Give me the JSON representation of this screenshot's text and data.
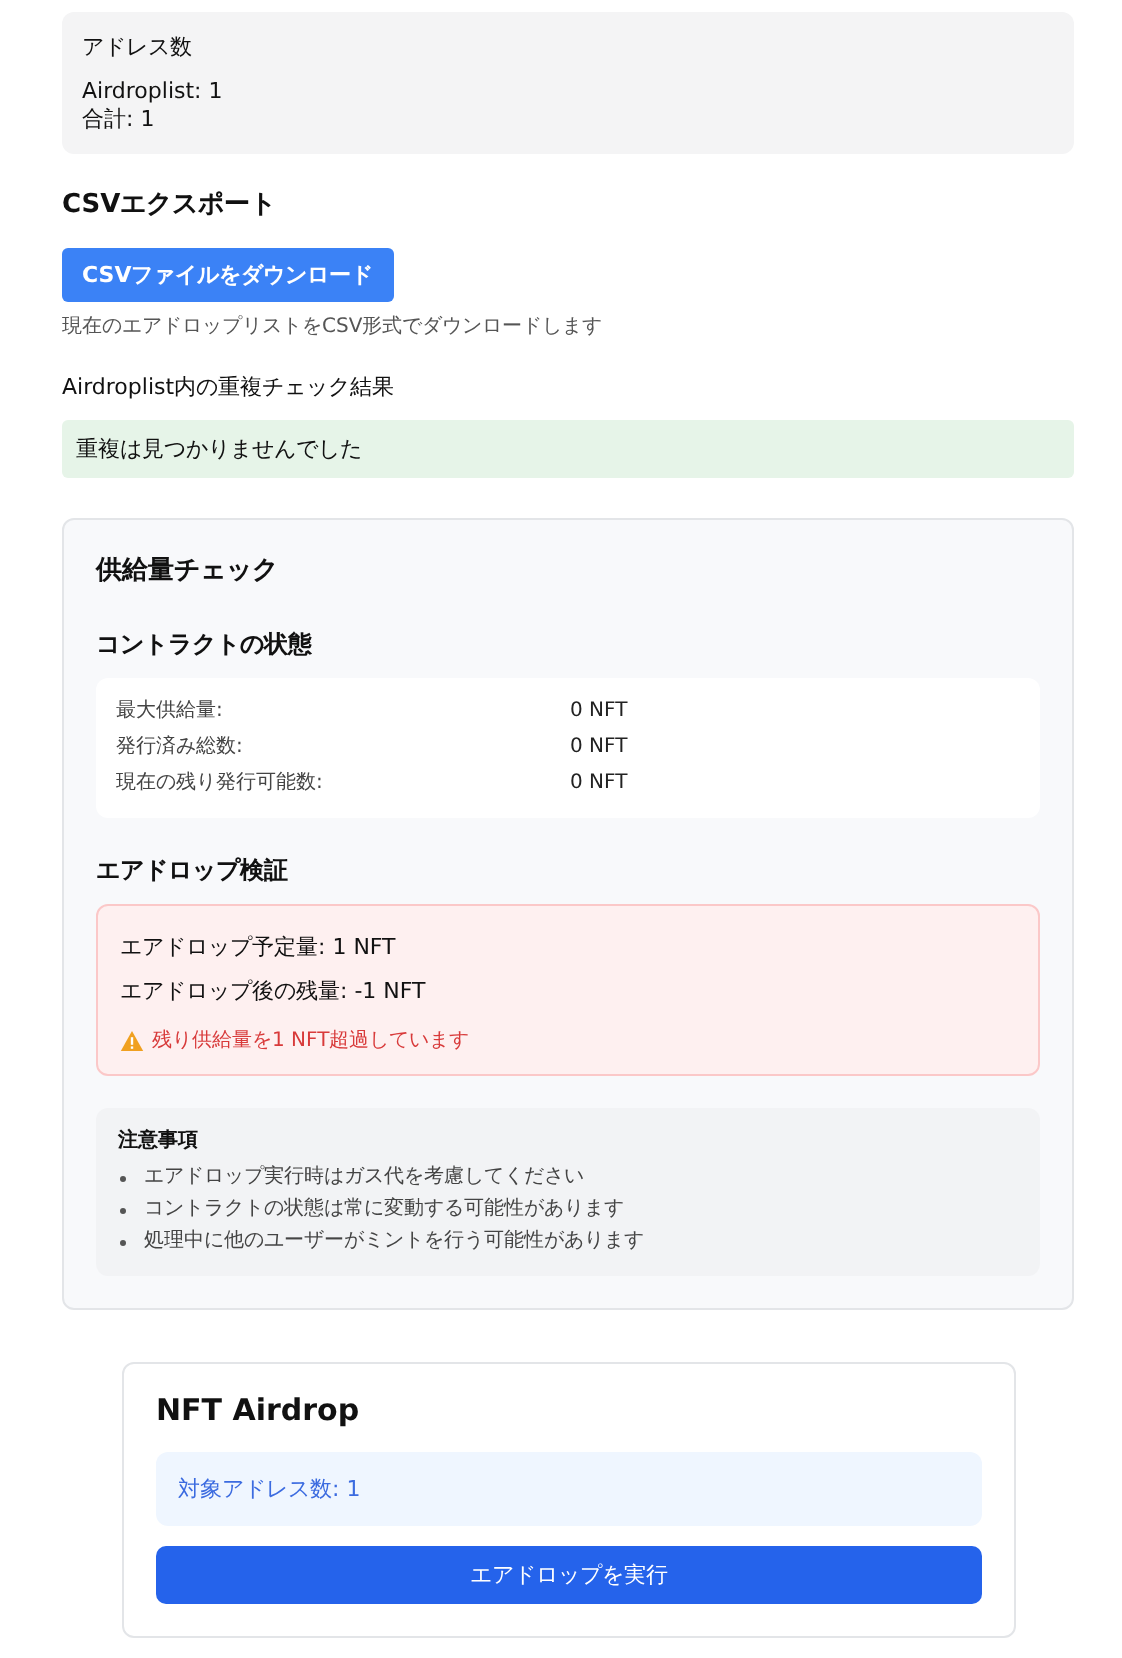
{
  "address_count": {
    "title": "アドレス数",
    "lines": [
      "Airdroplist: 1",
      "合計: 1"
    ]
  },
  "csv_export": {
    "heading": "CSVエクスポート",
    "button": "CSVファイルをダウンロード",
    "hint": "現在のエアドロップリストをCSV形式でダウンロードします"
  },
  "duplicate_check": {
    "heading": "Airdroplist内の重複チェック結果",
    "result": "重複は見つかりませんでした",
    "error": false
  },
  "supply_check": {
    "title": "供給量チェック",
    "contract_heading": "コントラクトの状態",
    "contract_rows": [
      {
        "label": "最大供給量:",
        "value": "0 NFT"
      },
      {
        "label": "発行済み総数:",
        "value": "0 NFT"
      },
      {
        "label": "現在の残り発行可能数:",
        "value": "0 NFT"
      }
    ],
    "verify_heading": "エアドロップ検証",
    "verify": {
      "error": true,
      "lines": [
        "エアドロップ予定量: 1 NFT",
        "エアドロップ後の残量: -1 NFT"
      ],
      "warning": "残り供給量を1 NFT超過しています"
    },
    "notes": {
      "title": "注意事項",
      "items": [
        "エアドロップ実行時はガス代を考慮してください",
        "コントラクトの状態は常に変動する可能性があります",
        "処理中に他のユーザーがミントを行う可能性があります"
      ]
    }
  },
  "airdrop": {
    "title": "NFT Airdrop",
    "target": "対象アドレス数: 1",
    "button": "エアドロップを実行"
  }
}
